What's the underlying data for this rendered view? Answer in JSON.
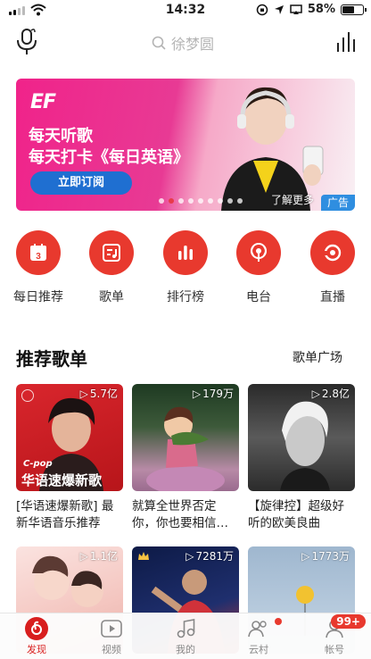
{
  "status_bar": {
    "time": "14:32",
    "battery": "58%",
    "battery_level": 0.58
  },
  "header": {
    "search_placeholder": "徐梦圆",
    "icons": [
      "microphone-icon",
      "search-icon",
      "equalizer-icon"
    ]
  },
  "banner": {
    "logo": "EF",
    "line1": "每天听歌",
    "line2": "每天打卡《每日英语》",
    "button": "立即订阅",
    "more": "了解更多",
    "ad_tag": "广告",
    "page_count": 9,
    "active_page": 1
  },
  "shortcuts": [
    {
      "label": "每日推荐",
      "icon": "calendar-icon",
      "badge": "3"
    },
    {
      "label": "歌单",
      "icon": "playlist-icon"
    },
    {
      "label": "排行榜",
      "icon": "chart-bars-icon"
    },
    {
      "label": "电台",
      "icon": "radio-icon"
    },
    {
      "label": "直播",
      "icon": "live-icon"
    }
  ],
  "recommended": {
    "title": "推荐歌单",
    "link": "歌单广场",
    "cards": [
      {
        "plays": "5.7亿",
        "title": "[华语速爆新歌] 最新华语音乐推荐",
        "cover_text1": "C-pop",
        "cover_text2": "华语速爆新歌"
      },
      {
        "plays": "179万",
        "title": "就算全世界否定你，你也要相信…"
      },
      {
        "plays": "2.8亿",
        "title": "【旋律控】超级好听的欧美良曲"
      },
      {
        "plays": "1.1亿",
        "title": ""
      },
      {
        "plays": "7281万",
        "title": ""
      },
      {
        "plays": "1773万",
        "title": ""
      }
    ]
  },
  "tabbar": {
    "tabs": [
      {
        "label": "发现",
        "icon": "netease-logo-icon",
        "active": true
      },
      {
        "label": "视频",
        "icon": "video-icon"
      },
      {
        "label": "我的",
        "icon": "music-note-icon"
      },
      {
        "label": "云村",
        "icon": "friends-icon"
      },
      {
        "label": "帐号",
        "icon": "account-icon"
      }
    ],
    "badge": "99+"
  },
  "colors": {
    "accent": "#e8392e",
    "banner_pink": "#f0238a",
    "banner_button": "#1f6fd1",
    "ad_tag": "#2f8ee0"
  }
}
